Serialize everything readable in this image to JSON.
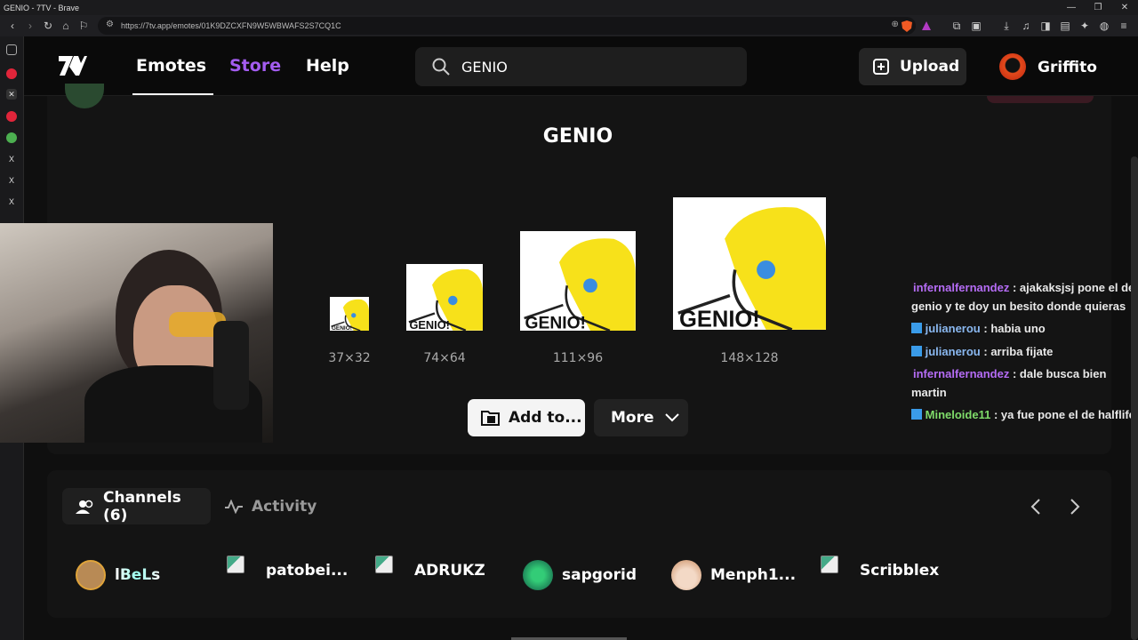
{
  "browser": {
    "window_title": "GENIO - 7TV - Brave",
    "url": "https://7tv.app/emotes/01K9DZCXFN9W5WBWAFS2S7CQ1C",
    "controls": {
      "minimize": "—",
      "restore": "❐",
      "close": "✕"
    }
  },
  "header": {
    "logo": "7TV",
    "nav": [
      {
        "label": "Emotes",
        "color": "#ffffff"
      },
      {
        "label": "Store",
        "color": "#a35cf0"
      },
      {
        "label": "Help",
        "color": "#ffffff"
      }
    ],
    "search_value": "GENIO",
    "upload_label": "Upload",
    "username": "Griffito"
  },
  "emote": {
    "title": "GENIO",
    "image_text": "GENIO!",
    "sizes": [
      "37×32",
      "74×64",
      "111×96",
      "148×128"
    ],
    "add_label": "Add to...",
    "more_label": "More"
  },
  "chat": [
    {
      "user": "infernalfernandez",
      "color": "#b56cf5",
      "badge": false,
      "text": ": ajakaksjsj pone el de genio y te doy un besito donde quieras"
    },
    {
      "user": "julianerou",
      "color": "#8ab8f0",
      "badge": true,
      "text": ": habia uno"
    },
    {
      "user": "julianerou",
      "color": "#8ab8f0",
      "badge": true,
      "text": ": arriba fijate"
    },
    {
      "user": "infernalfernandez",
      "color": "#b56cf5",
      "badge": false,
      "text": ": dale busca bien martin"
    },
    {
      "user": "Mineloide11",
      "color": "#7fdc6a",
      "badge": true,
      "text": ": ya fue pone el de halflife"
    }
  ],
  "channels_section": {
    "tab_channels": "Channels (6)",
    "tab_activity": "Activity",
    "channels": [
      {
        "name": "lBeLs",
        "avatar": true
      },
      {
        "name": "patobei...",
        "avatar": false
      },
      {
        "name": "ADRUKZ",
        "avatar": false
      },
      {
        "name": "sapgorid",
        "avatar": true
      },
      {
        "name": "Menph1...",
        "avatar": true
      },
      {
        "name": "Scribblex",
        "avatar": false
      }
    ]
  }
}
